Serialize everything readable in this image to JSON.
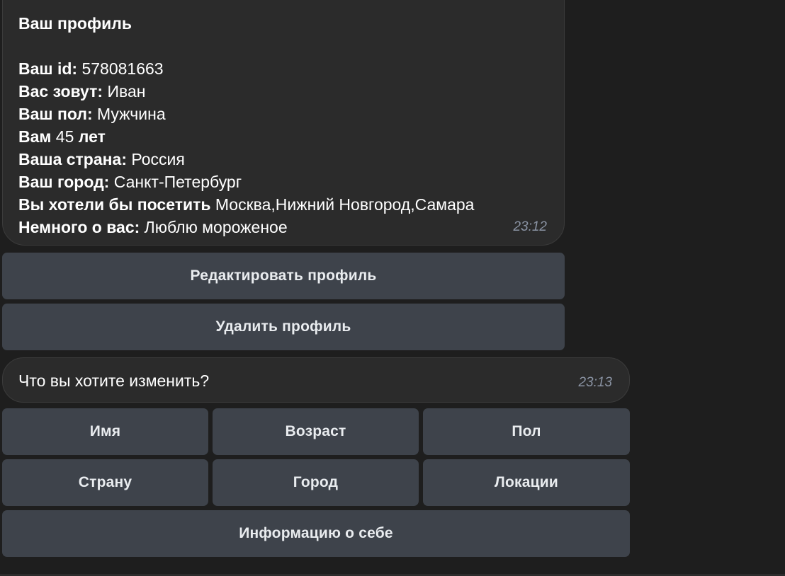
{
  "profile_message": {
    "title": "Ваш профиль",
    "lines": [
      {
        "label": "Ваш id:",
        "value": " 578081663"
      },
      {
        "label": "Вас зовут:",
        "value": " Иван"
      },
      {
        "label": "Ваш пол:",
        "value": " Мужчина"
      },
      {
        "label": "Вам",
        "value": " 45 ",
        "suffix": "лет"
      },
      {
        "label": "Ваша страна:",
        "value": " Россия"
      },
      {
        "label": "Ваш город:",
        "value": " Санкт-Петербург"
      },
      {
        "label": "Вы хотели бы посетить",
        "value": " Москва,Нижний Новгород,Самара"
      },
      {
        "label": "Немного о вас:",
        "value": " Люблю мороженое"
      }
    ],
    "time": "23:12"
  },
  "profile_buttons": {
    "edit": "Редактировать профиль",
    "delete": "Удалить профиль"
  },
  "question_message": {
    "text": "Что вы хотите изменить?",
    "time": "23:13"
  },
  "edit_buttons": {
    "name": "Имя",
    "age": "Возраст",
    "gender": "Пол",
    "country": "Страну",
    "city": "Город",
    "locations": "Локации",
    "about": "Информацию о себе"
  },
  "colors": {
    "background": "#1e1e1e",
    "bubble": "#2b2b2b",
    "button": "#3e434b",
    "timestamp": "#8a93a3"
  }
}
